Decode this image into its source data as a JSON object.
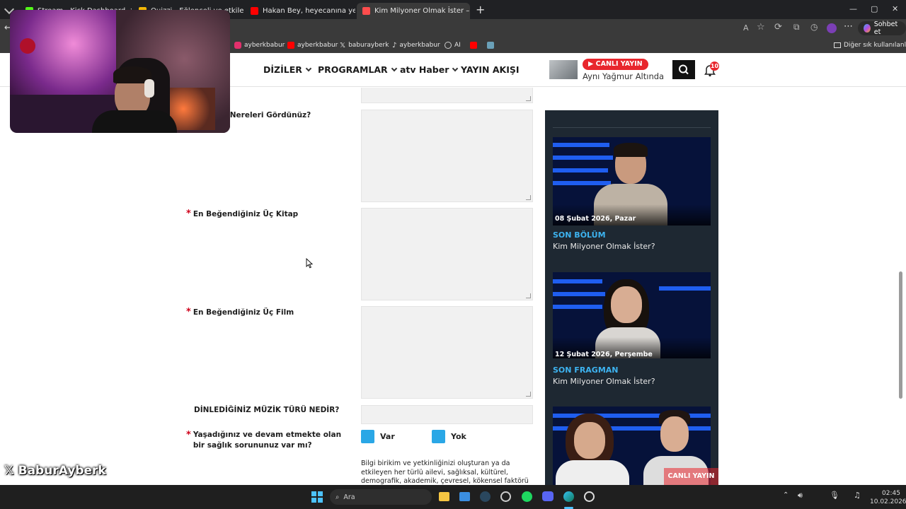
{
  "browser": {
    "tabs": [
      {
        "title": "Stream - Kick Dashboard",
        "color": "#53fc18"
      },
      {
        "title": "Quizzi - Eğlenceli ve etkileşimli q",
        "color": "#f2b705"
      },
      {
        "title": "Hakan Bey, heyecanına yenik düş",
        "color": "#ff0000"
      },
      {
        "title": "Kim Milyoner Olmak İster – Başvu",
        "color": "#ff4d4d"
      }
    ],
    "new_tab": "+",
    "chat_button": "Sohbet et",
    "bookmarks": [
      {
        "label": "ayberkbabur",
        "icon": "instagram-icon",
        "color": "#e1306c"
      },
      {
        "label": "ayberkbabur",
        "icon": "youtube-icon",
        "color": "#ff0000"
      },
      {
        "label": "baburayberk",
        "icon": "x-icon",
        "color": "#ffffff"
      },
      {
        "label": "ayberkbabur",
        "icon": "tiktok-icon",
        "color": "#ffffff"
      },
      {
        "label": "AI",
        "icon": "ai-icon",
        "color": "#cccccc"
      }
    ],
    "other_bookmarks": "Diğer sık kullanılanlar"
  },
  "site": {
    "nav": [
      "DİZİLER",
      "PROGRAMLAR",
      "atv Haber",
      "YAYIN AKIŞI"
    ],
    "live_badge": "▶ CANLI YAYIN",
    "live_show": "Aynı Yağmur Altında",
    "notification_count": "10"
  },
  "form": {
    "fields": [
      {
        "label": "a Nereleri Gördünüz?",
        "required": false
      },
      {
        "label": "En Beğendiğiniz Üç Kitap",
        "required": true
      },
      {
        "label": "En Beğendiğiniz Üç Film",
        "required": true
      },
      {
        "label": "DİNLEDİĞİNİZ MÜZİK TÜRÜ NEDİR?",
        "required": false
      }
    ],
    "health_question": "Yaşadığınız ve devam etmekte olan bir sağlık sorununuz var mı?",
    "option_yes": "Var",
    "option_no": "Yok",
    "consent_text": "Bilgi birikim ve yetkinliğinizi oluşturan ya da etkileyen her türlü ailevi, sağlıksal, kültürel, demografik, akademik, çevresel, kökensel faktörü bize iletti ğiniz"
  },
  "sidebar": {
    "cards": [
      {
        "date": "08 Şubat 2026, Pazar",
        "category": "SON BÖLÜM",
        "title": "Kim Milyoner Olmak İster?"
      },
      {
        "date": "12 Şubat 2026, Perşembe",
        "category": "SON FRAGMAN",
        "title": "Kim Milyoner Olmak İster?"
      }
    ],
    "live_label": "CANLI YAYIN"
  },
  "taskbar": {
    "search": "Ara",
    "time": "02:45",
    "date": "10.02.2026"
  },
  "overlay": {
    "watermark": "BaburAyberk"
  },
  "colors": {
    "accent_blue": "#2aa7e6",
    "live_red": "#e8262d",
    "sidebar_bg": "#1e2832",
    "category_blue": "#3db3f0"
  }
}
